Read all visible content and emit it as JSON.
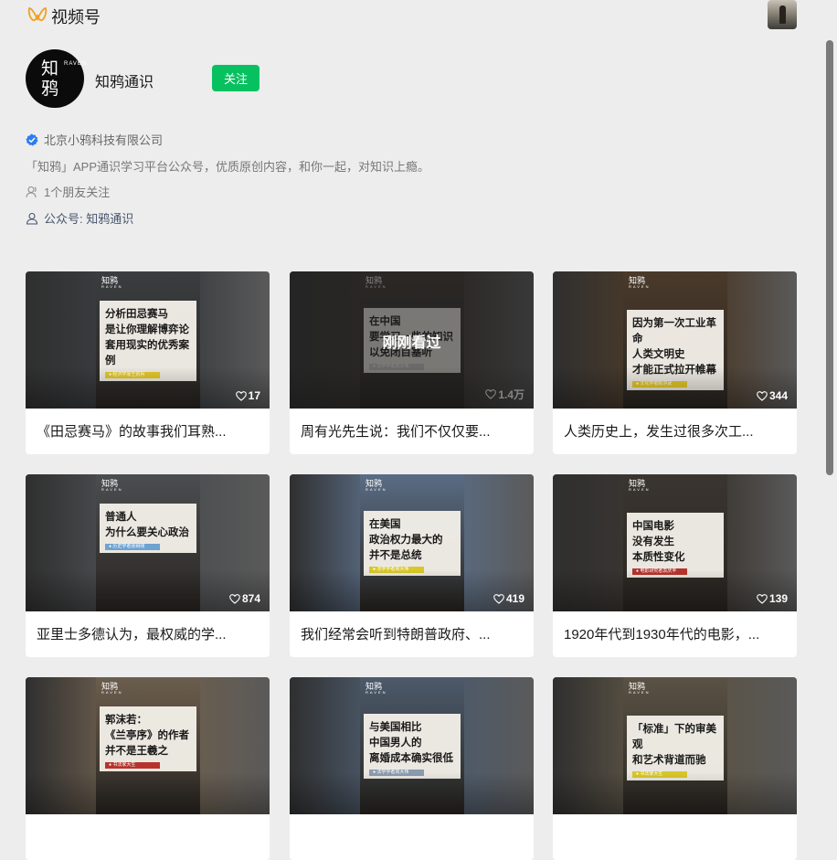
{
  "header": {
    "app_title": "视频号"
  },
  "profile": {
    "avatar_cn": "知鸦",
    "avatar_en": "RAVEN",
    "name": "知鸦通识",
    "follow_label": "关注",
    "verified_org": "北京小鸦科技有限公司",
    "description": "「知鸦」APP通识学习平台公众号，优质原创内容，和你一起，对知识上瘾。",
    "friends_following": "1个朋友关注",
    "official_account": "公众号: 知鸦通识"
  },
  "videos": [
    {
      "headline": "分析田忌赛马\n是让你理解博弈论\n套用现实的优秀案例",
      "tag": "● 经济学家王则柯",
      "likes": "17",
      "caption": "《田忌赛马》的故事我们耳熟...",
      "brand": "知鸦",
      "brand_en": "RAVEN",
      "tag_color": "#e2c628",
      "bg": "#3a3d40"
    },
    {
      "headline": "在中国\n要学习一些的知识\n以免闭目塞听",
      "tag": "● 法学学者周大伟",
      "likes": "1.4万",
      "caption": "周有光先生说：我们不仅仅要...",
      "watched": "刚刚看过",
      "brand": "知鸦",
      "brand_en": "RAVEN",
      "tag_color": "#c7c7c7",
      "bg": "#3b3430"
    },
    {
      "headline": "因为第一次工业革命\n人类文明史\n才能正式拉开帷幕",
      "tag": "● 文化学者陈洪武",
      "likes": "344",
      "caption": "人类历史上，发生过很多次工...",
      "brand": "知鸦",
      "brand_en": "RAVEN",
      "tag_color": "#e2c628",
      "bg": "#4a3a2a"
    },
    {
      "headline": "普通人\n为什么要关心政治",
      "tag": "● 历史学者张树刚",
      "likes": "874",
      "caption": "亚里士多德认为，最权威的学...",
      "brand": "知鸦",
      "brand_en": "RAVEN",
      "tag_color": "#6ea2d1",
      "bg": "#4b4d50"
    },
    {
      "headline": "在美国\n政治权力最大的\n并不是总统",
      "tag": "● 法学学者周大伟",
      "likes": "419",
      "caption": "我们经常会听到特朗普政府、...",
      "brand": "知鸦",
      "brand_en": "RAVEN",
      "tag_color": "#d8c72a",
      "bg": "#5a6c85"
    },
    {
      "headline": "中国电影\n没有发生\n本质性变化",
      "tag": "● 电影研究者袁庆丰",
      "likes": "139",
      "caption": "1920年代到1930年代的电影，...",
      "brand": "知鸦",
      "brand_en": "RAVEN",
      "tag_color": "#b8332c",
      "bg": "#3a3530"
    },
    {
      "headline": "郭沫若：\n《兰亭序》的作者\n并不是王羲之",
      "tag": "● 书法家大生",
      "likes": "",
      "caption": "",
      "brand": "知鸦",
      "brand_en": "RAVEN",
      "tag_color": "#b8332c",
      "bg": "#6b5e4e"
    },
    {
      "headline": "与美国相比\n中国男人的\n离婚成本确实很低",
      "tag": "● 法学学者周大伟",
      "likes": "",
      "caption": "",
      "brand": "知鸦",
      "brand_en": "RAVEN",
      "tag_color": "#8a9bb0",
      "bg": "#4c5a6b"
    },
    {
      "headline": "「标准」下的审美观\n和艺术背道而驰",
      "tag": "● 书法家大生",
      "likes": "",
      "caption": "",
      "brand": "知鸦",
      "brand_en": "RAVEN",
      "tag_color": "#d8c72a",
      "bg": "#5a5244"
    }
  ]
}
